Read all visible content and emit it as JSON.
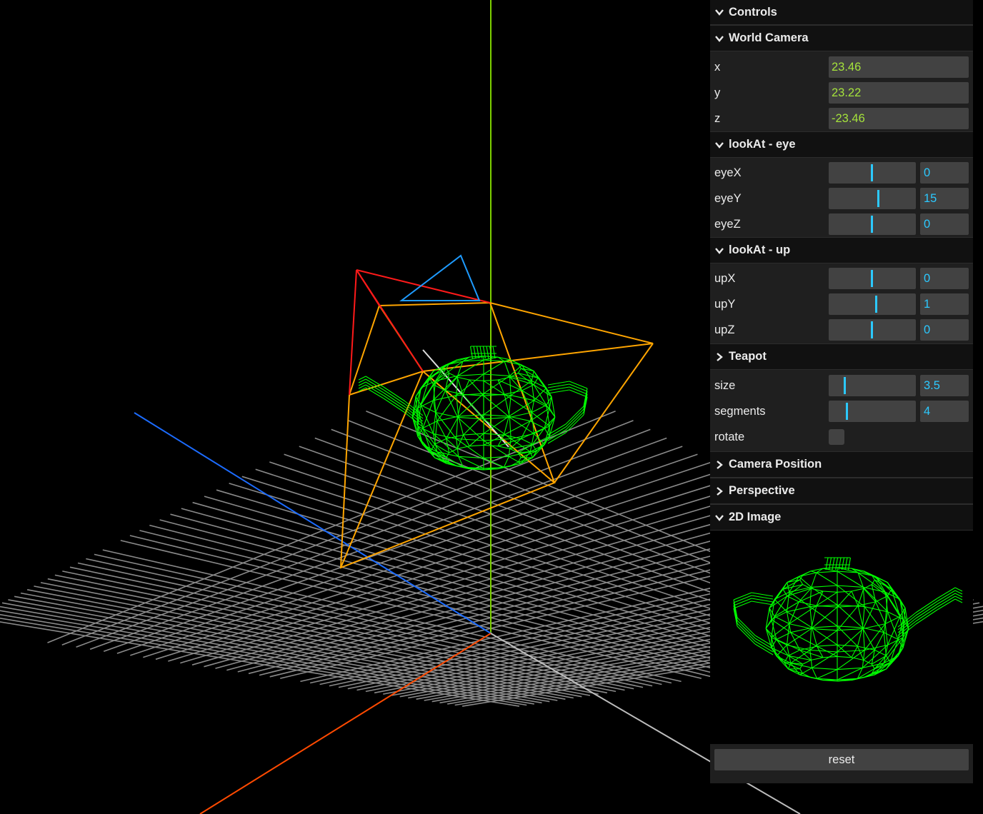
{
  "panel": {
    "title": "Controls",
    "world_camera": {
      "title": "World Camera",
      "x_label": "x",
      "x": "23.46",
      "y_label": "y",
      "y": "23.22",
      "z_label": "z",
      "z": "-23.46"
    },
    "eye": {
      "title": "lookAt - eye",
      "eyeX_label": "eyeX",
      "eyeX": "0",
      "eyeY_label": "eyeY",
      "eyeY": "15",
      "eyeZ_label": "eyeZ",
      "eyeZ": "0"
    },
    "up": {
      "title": "lookAt - up",
      "upX_label": "upX",
      "upX": "0",
      "upY_label": "upY",
      "upY": "1",
      "upZ_label": "upZ",
      "upZ": "0"
    },
    "teapot": {
      "title": "Teapot",
      "size_label": "size",
      "size": "3.5",
      "segments_label": "segments",
      "segments": "4",
      "rotate_label": "rotate"
    },
    "camera_position": {
      "title": "Camera Position"
    },
    "perspective": {
      "title": "Perspective"
    },
    "image": {
      "title": "2D Image"
    },
    "reset_label": "reset"
  },
  "colors": {
    "wire": "#00ff00",
    "frustum": "#ffa500",
    "camera": "#ff0000",
    "up_marker": "#1e9bff",
    "grid": "#8a8a8a",
    "accent": "#2cc9ff",
    "number": "#a5e33b"
  }
}
